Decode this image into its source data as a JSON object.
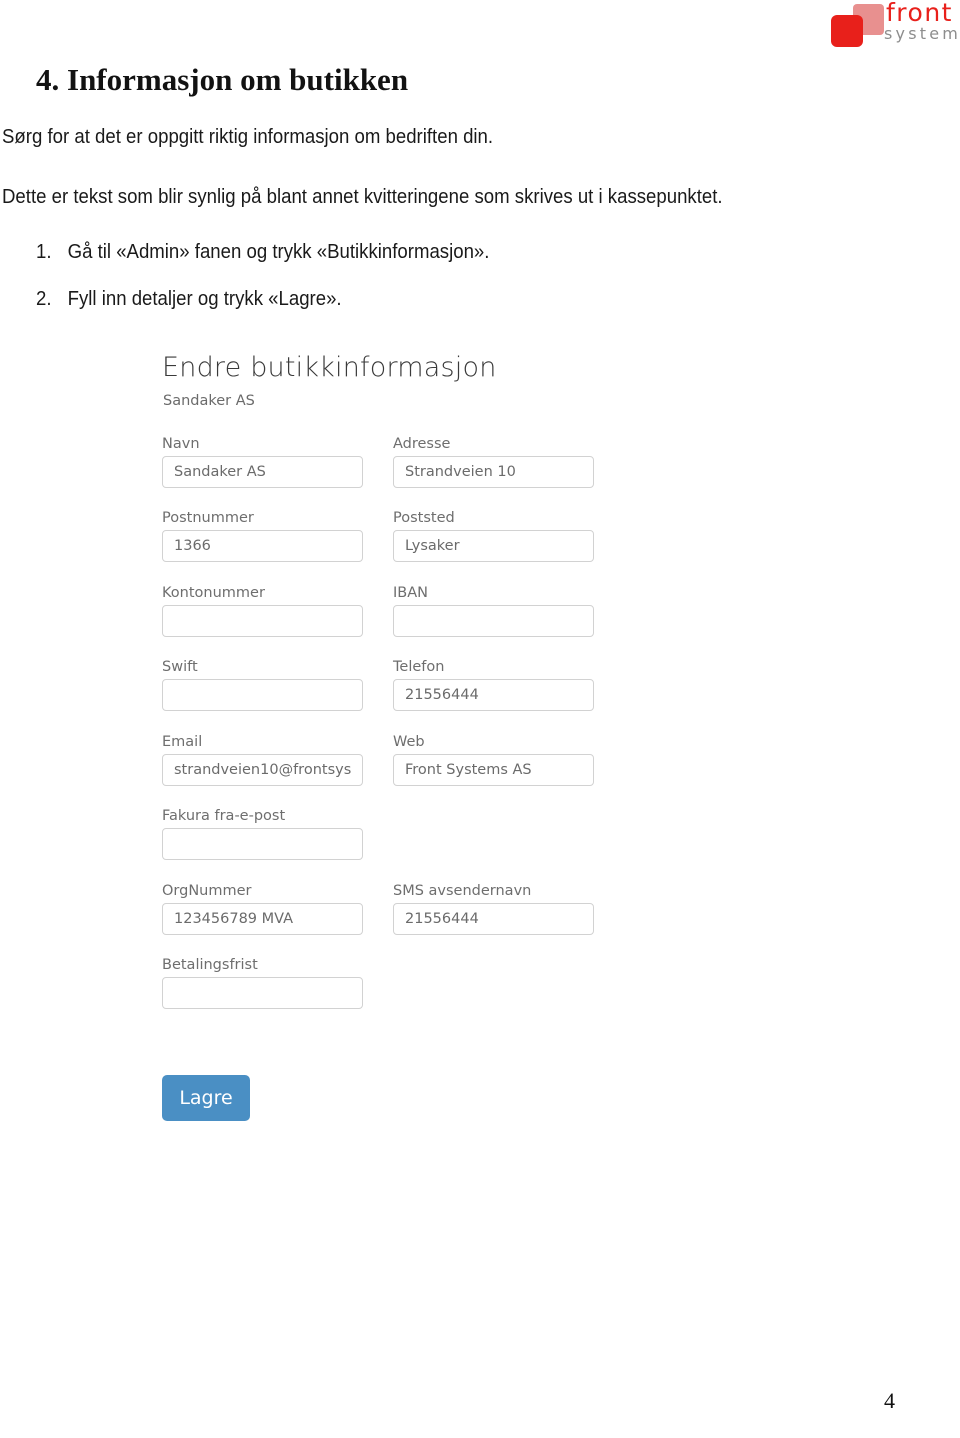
{
  "logo": {
    "name": "front systems",
    "word_front": "front",
    "word_systems": "systems",
    "color_red": "#e8201b",
    "color_pink": "#e8908f",
    "color_gray": "#8d8d8d"
  },
  "document": {
    "heading": "4. Informasjon om butikken",
    "paragraphs": [
      "Sørg for at det er oppgitt riktig informasjon om bedriften din.",
      "Dette er tekst som blir synlig på blant annet kvitteringene som skrives ut i kassepunktet."
    ],
    "steps": [
      {
        "number": "1.",
        "text": "Gå til «Admin» fanen og trykk «Butikkinformasjon»."
      },
      {
        "number": "2.",
        "text": "Fyll inn detaljer og trykk «Lagre»."
      }
    ],
    "page_number": "4"
  },
  "app_form": {
    "title": "Endre butikkinformasjon",
    "subtitle": "Sandaker AS",
    "accent_color": "#4a8fc4",
    "fields": [
      {
        "label": "Navn",
        "value": "Sandaker AS"
      },
      {
        "label": "Adresse",
        "value": "Strandveien 10"
      },
      {
        "label": "Postnummer",
        "value": "1366"
      },
      {
        "label": "Poststed",
        "value": "Lysaker"
      },
      {
        "label": "Kontonummer",
        "value": ""
      },
      {
        "label": "IBAN",
        "value": ""
      },
      {
        "label": "Swift",
        "value": ""
      },
      {
        "label": "Telefon",
        "value": "21556444"
      },
      {
        "label": "Email",
        "value": "strandveien10@frontsys"
      },
      {
        "label": "Web",
        "value": "Front Systems AS"
      },
      {
        "label": "Fakura fra-e-post",
        "value": ""
      },
      {
        "label": "OrgNummer",
        "value": "123456789 MVA"
      },
      {
        "label": "SMS avsendernavn",
        "value": "21556444"
      },
      {
        "label": "Betalingsfrist",
        "value": ""
      }
    ],
    "save_label": "Lagre"
  }
}
